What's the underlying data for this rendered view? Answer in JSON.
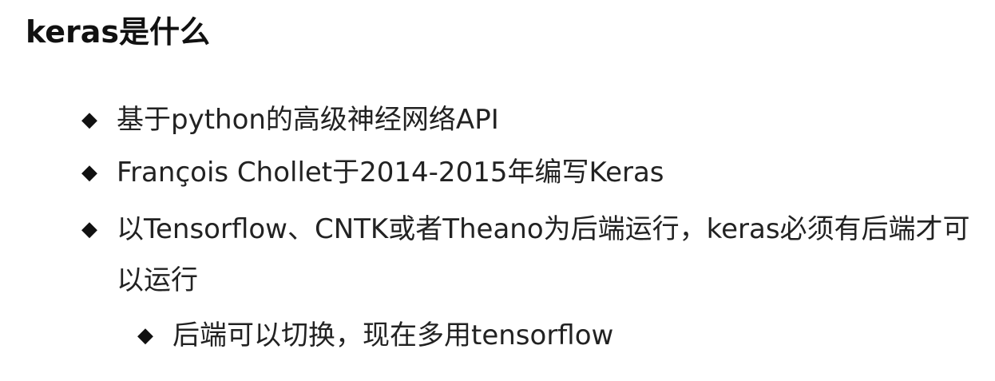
{
  "title": "keras是什么",
  "bullets": [
    {
      "marker": "◆",
      "text": "基于python的高级神经网络API"
    },
    {
      "marker": "◆",
      "text": "François Chollet于2014-2015年编写Keras"
    },
    {
      "marker": "◆",
      "text": "以Tensorflow、CNTK或者Theano为后端运行，keras必须有后端才可以运行"
    }
  ],
  "sub_bullets": [
    {
      "marker": "◆",
      "text": "后端可以切换，现在多用tensorflow"
    }
  ]
}
